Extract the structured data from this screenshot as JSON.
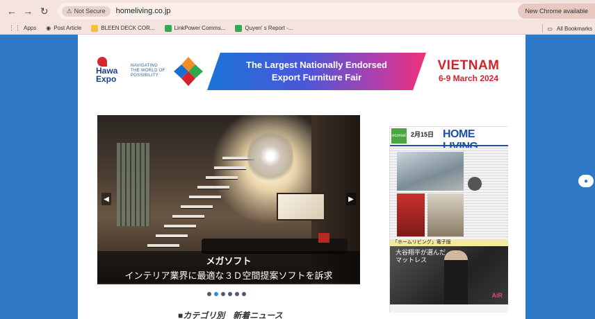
{
  "browser": {
    "security_chip": "Not Secure",
    "url": "homeliving.co.jp",
    "update_button": "New Chrome available",
    "bookmarks": [
      {
        "label": "Apps",
        "color": "#5f6368"
      },
      {
        "label": "Post Article",
        "color": "#3c4043"
      },
      {
        "label": "BLEEN DECK COR...",
        "color": "#f4c430"
      },
      {
        "label": "LinkPower Comms...",
        "color": "#34a853"
      },
      {
        "label": "Quyen' s Report -...",
        "color": "#34a853"
      }
    ],
    "all_bookmarks": "All Bookmarks"
  },
  "banner": {
    "hawa_line1": "Hawa",
    "hawa_line2": "Expo",
    "tagline_1": "NAVIGATING",
    "tagline_2": "THE WORLD OF",
    "tagline_3": "POSSIBILITY",
    "headline_1": "The Largest Nationally Endorsed",
    "headline_2": "Export Furniture Fair",
    "country": "VIETNAM",
    "dates": "6-9 March 2024"
  },
  "slider": {
    "title": "メガソフト",
    "subtitle": "インテリア業界に最適な３Ｄ空間提案ソフトを訴求",
    "prev_arrow": "◀",
    "next_arrow": "▶",
    "slide_count": 6,
    "active_index": 1
  },
  "section": {
    "title": "■カテゴリ別　新着ニュース"
  },
  "magazine": {
    "masthead": "HOME LIVING",
    "issue_date": "2月15日",
    "badge": "ecoreal",
    "strip": "「ホームリビング」電子版",
    "ad_text_1": "大谷翔平が選んだ",
    "ad_text_2": "マットレス",
    "ad_logo": "AiR"
  }
}
